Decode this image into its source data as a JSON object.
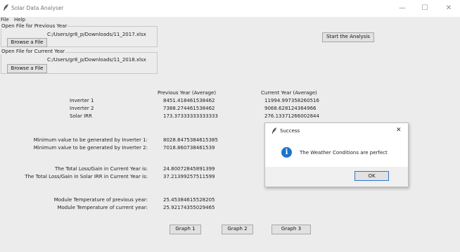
{
  "window": {
    "title": "Solar Data Analyser",
    "minimize_glyph": "—",
    "maximize_glyph": "☐",
    "close_glyph": "✕"
  },
  "menu": [
    "File",
    "Help"
  ],
  "previous_year": {
    "frame_label": "Open File for Previous Year",
    "path": "C:/Users/gr8_p/Downloads/11_2017.xlsx",
    "browse_label": "Browse a File"
  },
  "current_year": {
    "frame_label": "Open File for Current Year",
    "path": "C:/Users/gr8_p/Downloads/11_2018.xlsx",
    "browse_label": "Browse a File"
  },
  "start_button": "Start the Analysis",
  "averages": {
    "previous_header": "Previous Year (Average)",
    "current_header": "Current Year (Average)",
    "rows": [
      {
        "label": "Inverter 1",
        "previous": "8451.418461538462",
        "current": "11994.997358260516"
      },
      {
        "label": "Inverter 2",
        "previous": "7388.274461538462",
        "current": "9068.628124364966"
      },
      {
        "label": "Solar IRR",
        "previous": "173.37333333333333",
        "current": "276.13371266002844"
      }
    ]
  },
  "minimum": [
    {
      "label": "Minimum value to be generated by Inverter 1:",
      "value": "8028.8475384615385"
    },
    {
      "label": "Minimum value to be generated by Inverter 2:",
      "value": "7018.860738461539"
    }
  ],
  "loss_gain": [
    {
      "label": "The Total Loss/Gain in Current Year is:",
      "value": "24.80072845891399"
    },
    {
      "label": "The Total Loss/Gain in Solar IRR in Current Year is:",
      "value": "37.21399257511599"
    }
  ],
  "module_temp": [
    {
      "label": "Module Temperature of previous year:",
      "value": "25.45384615528205"
    },
    {
      "label": "Module Temperature of current year:",
      "value": "25.92174355029465"
    }
  ],
  "graph_buttons": [
    "Graph 1",
    "Graph 2",
    "Graph 3"
  ],
  "dialog": {
    "title": "Success",
    "message": "The Weather Conditions are perfect",
    "ok_label": "OK",
    "close_glyph": "✕",
    "info_glyph": "i"
  },
  "colors": {
    "info_icon": "#1e73c9",
    "ok_border": "#2f73c9"
  }
}
